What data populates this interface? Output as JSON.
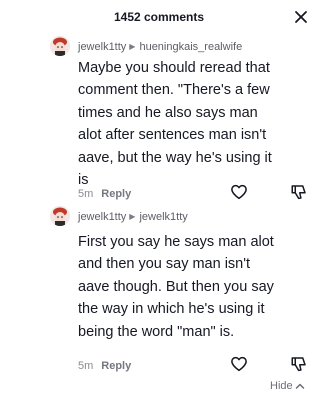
{
  "header": {
    "title": "1452 comments",
    "close_icon": "close-icon"
  },
  "comments": [
    {
      "author": "jewelk1tty",
      "reply_to": "hueningkais_realwife",
      "text": "Maybe you should reread that comment then. \"There's a few times and he also says man alot after sentences man isn't aave, but the way he's using it is",
      "time": "5m",
      "reply_label": "Reply",
      "like_icon": "heart-outline-icon",
      "dislike_icon": "thumbs-down-icon"
    },
    {
      "author": "jewelk1tty",
      "reply_to": "jewelk1tty",
      "text": "First you say he says man alot and then you say man isn't aave though. But then you say the way in which he's using it being the word \"man\" is.",
      "time": "5m",
      "reply_label": "Reply",
      "like_icon": "heart-outline-icon",
      "dislike_icon": "thumbs-down-icon"
    }
  ],
  "footer": {
    "hide_label": "Hide",
    "hide_icon": "chevron-up-icon"
  }
}
